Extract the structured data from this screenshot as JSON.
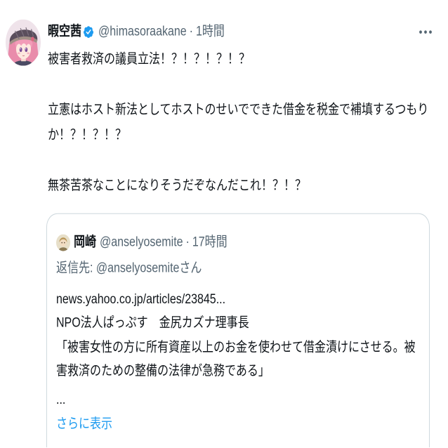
{
  "tweet": {
    "author": {
      "name": "暇空茜",
      "handle": "@himasoraakane",
      "separator": "·",
      "time": "1時間",
      "verified": true
    },
    "text": "被害者救済の議員立法！？！？！？！？\n\n立憲はホスト新法としてホストのせいでできた借金を税金で補填するつもりか！？！？！？\n\n無茶苦茶なことになりそうだぞなんだこれ！？！？",
    "quoted": {
      "author": {
        "name": "岡崎",
        "handle": "@anselyosemite",
        "separator": "·",
        "time": "17時間"
      },
      "reply_to": "返信先: @anselyosemiteさん",
      "text": "news.yahoo.co.jp/articles/23845...\nNPO法人ぱっぷす　金尻カズナ理事長\n「被害女性の方に所有資産以上のお金を使わせて借金漬けにさせる。被害救済のための整備の法律が急務である」",
      "ellipsis": "...",
      "show_more": "さらに表示"
    }
  },
  "icons": {
    "more": "more-icon",
    "verified": "verified-badge-icon"
  },
  "colors": {
    "text": "#0f1419",
    "secondary": "#536471",
    "accent": "#1d9bf0",
    "border": "#cfd9de",
    "background": "#ffffff"
  }
}
